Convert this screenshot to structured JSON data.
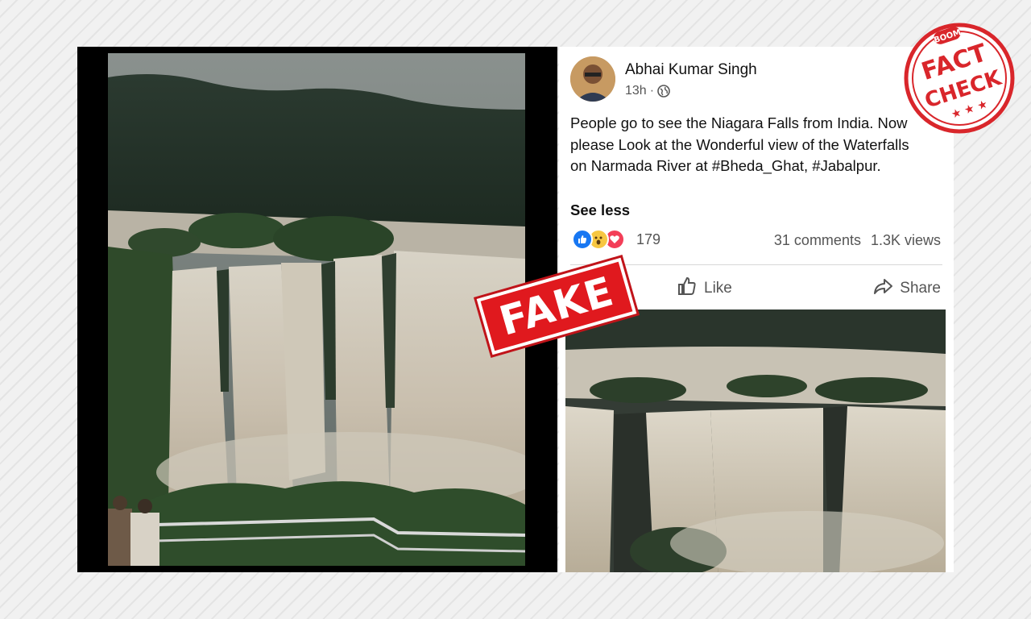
{
  "post": {
    "author": "Abhai Kumar Singh",
    "time": "13h",
    "separator": "·",
    "audience_icon": "globe-icon",
    "text": "People go to see the Niagara Falls from India. Now please Look at the Wonderful view of the Waterfalls on Narmada River at #Bheda_Ghat, #Jabalpur.",
    "see_less": "See less",
    "reactions": [
      "like",
      "wow",
      "love"
    ],
    "reaction_count": "179",
    "comments": "31 comments",
    "views": "1.3K views",
    "actions": {
      "like": "Like",
      "share": "Share"
    }
  },
  "stamps": {
    "fake": "FAKE",
    "fact_check": {
      "brand": "BOOM",
      "line1": "FACT",
      "line2": "CHECK"
    }
  },
  "colors": {
    "stamp_red": "#e0191e",
    "facebook_blue": "#1877f2"
  }
}
